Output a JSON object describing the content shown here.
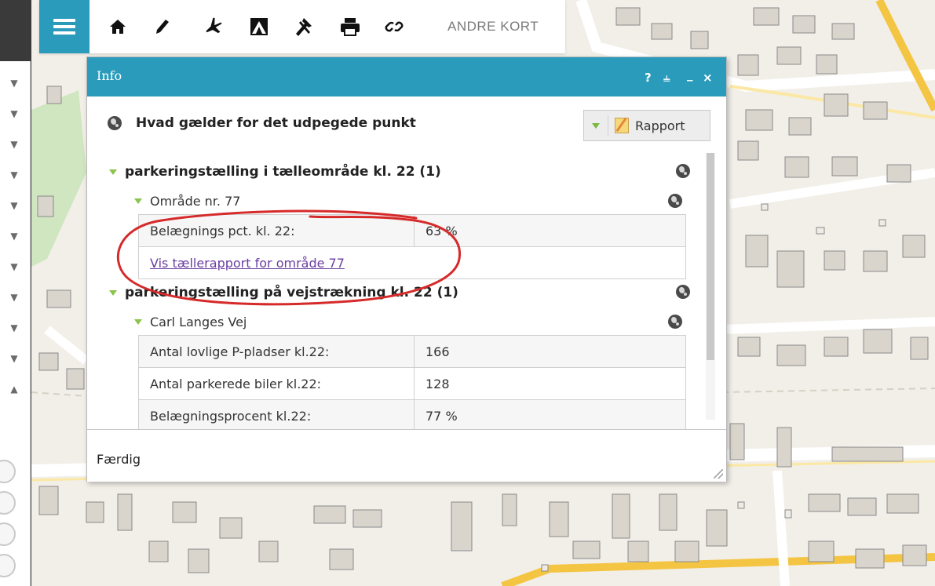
{
  "toolbar": {
    "menu_icon": "hamburger-icon",
    "tools": [
      "home-icon",
      "pencil-icon",
      "plane-icon",
      "measure-icon",
      "tools-icon",
      "print-icon",
      "link-icon"
    ],
    "other_maps_label": "ANDRE KORT",
    "accent_color": "#2a9bbb"
  },
  "side_controls": {
    "icons": [
      "chevron-down-icon",
      "chevron-down-icon",
      "chevron-down-icon",
      "chevron-down-icon",
      "chevron-down-icon",
      "chevron-down-icon",
      "chevron-down-icon",
      "chevron-down-icon",
      "chevron-down-icon",
      "chevron-down-icon",
      "chevron-up-icon"
    ]
  },
  "dialog": {
    "title": "Info",
    "controls": {
      "help": "?",
      "dock": "⫨",
      "minimize": "_",
      "close": "×"
    },
    "heading": "Hvad gælder for det udpegede punkt",
    "report_label": "Rapport",
    "sections": [
      {
        "title": "parkeringstælling i tælleområde kl. 22 (1)",
        "subtitle": "Område nr. 77",
        "rows": [
          {
            "label": "Belægnings pct. kl. 22:",
            "value": "63 %"
          }
        ],
        "link": "Vis tællerapport for område 77"
      },
      {
        "title": "parkeringstælling på vejstrækning kl. 22 (1)",
        "subtitle": "Carl Langes Vej",
        "rows": [
          {
            "label": "Antal lovlige P-pladser kl.22:",
            "value": "166"
          },
          {
            "label": "Antal parkerede biler kl.22:",
            "value": "128"
          },
          {
            "label": "Belægningsprocent kl.22:",
            "value": "77 %"
          }
        ]
      }
    ],
    "footer": "Færdig"
  }
}
